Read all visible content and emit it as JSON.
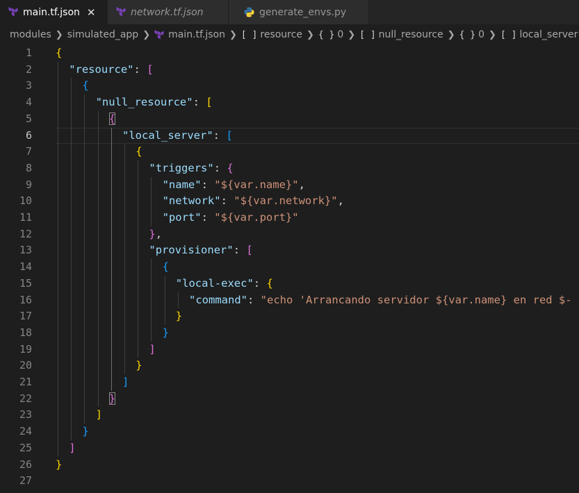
{
  "tabs": [
    {
      "label": "main.tf.json",
      "icon": "terraform-icon",
      "active": true,
      "italic": false,
      "close": "✕"
    },
    {
      "label": "network.tf.json",
      "icon": "terraform-icon",
      "active": false,
      "italic": true
    },
    {
      "label": "generate_envs.py",
      "icon": "python-icon",
      "active": false,
      "italic": false
    }
  ],
  "breadcrumb": [
    {
      "label": "modules"
    },
    {
      "label": "simulated_app"
    },
    {
      "label": "main.tf.json",
      "icon": "terraform-icon"
    },
    {
      "symbol": "[ ]",
      "label": "resource"
    },
    {
      "symbol": "{ }",
      "label": "0"
    },
    {
      "symbol": "[ ]",
      "label": "null_resource"
    },
    {
      "symbol": "{ }",
      "label": "0"
    },
    {
      "symbol": "[ ]",
      "label": "local_server"
    }
  ],
  "colors": {
    "terraform": "#7b42bc",
    "python_blue": "#3572a5",
    "python_yellow": "#ffd43b",
    "key": "#9cdcfe",
    "string": "#ce9178"
  },
  "editor": {
    "current_line": 6,
    "lines": [
      {
        "n": "1",
        "indent": 0,
        "tokens": [
          {
            "t": "{",
            "c": "b1"
          }
        ]
      },
      {
        "n": "2",
        "indent": 1,
        "tokens": [
          {
            "t": "\"resource\"",
            "c": "k"
          },
          {
            "t": ": ",
            "c": "p"
          },
          {
            "t": "[",
            "c": "b2"
          }
        ]
      },
      {
        "n": "3",
        "indent": 2,
        "tokens": [
          {
            "t": "{",
            "c": "b3"
          }
        ]
      },
      {
        "n": "4",
        "indent": 3,
        "tokens": [
          {
            "t": "\"null_resource\"",
            "c": "k"
          },
          {
            "t": ": ",
            "c": "p"
          },
          {
            "t": "[",
            "c": "b1"
          }
        ]
      },
      {
        "n": "5",
        "indent": 4,
        "tokens": [
          {
            "t": "{",
            "c": "b2",
            "boxed": true
          }
        ]
      },
      {
        "n": "6",
        "indent": 5,
        "tokens": [
          {
            "t": "\"local_server\"",
            "c": "k"
          },
          {
            "t": ": ",
            "c": "p"
          },
          {
            "t": "[",
            "c": "b3"
          }
        ]
      },
      {
        "n": "7",
        "indent": 6,
        "tokens": [
          {
            "t": "{",
            "c": "b1"
          }
        ]
      },
      {
        "n": "8",
        "indent": 7,
        "tokens": [
          {
            "t": "\"triggers\"",
            "c": "k"
          },
          {
            "t": ": ",
            "c": "p"
          },
          {
            "t": "{",
            "c": "b2"
          }
        ]
      },
      {
        "n": "9",
        "indent": 8,
        "tokens": [
          {
            "t": "\"name\"",
            "c": "k"
          },
          {
            "t": ": ",
            "c": "p"
          },
          {
            "t": "\"${var.name}\"",
            "c": "s"
          },
          {
            "t": ",",
            "c": "p"
          }
        ]
      },
      {
        "n": "10",
        "indent": 8,
        "tokens": [
          {
            "t": "\"network\"",
            "c": "k"
          },
          {
            "t": ": ",
            "c": "p"
          },
          {
            "t": "\"${var.network}\"",
            "c": "s"
          },
          {
            "t": ",",
            "c": "p"
          }
        ]
      },
      {
        "n": "11",
        "indent": 8,
        "tokens": [
          {
            "t": "\"port\"",
            "c": "k"
          },
          {
            "t": ": ",
            "c": "p"
          },
          {
            "t": "\"${var.port}\"",
            "c": "s"
          }
        ]
      },
      {
        "n": "12",
        "indent": 7,
        "tokens": [
          {
            "t": "}",
            "c": "b2"
          },
          {
            "t": ",",
            "c": "p"
          }
        ]
      },
      {
        "n": "13",
        "indent": 7,
        "tokens": [
          {
            "t": "\"provisioner\"",
            "c": "k"
          },
          {
            "t": ": ",
            "c": "p"
          },
          {
            "t": "[",
            "c": "b2"
          }
        ]
      },
      {
        "n": "14",
        "indent": 8,
        "tokens": [
          {
            "t": "{",
            "c": "b3"
          }
        ]
      },
      {
        "n": "15",
        "indent": 9,
        "tokens": [
          {
            "t": "\"local-exec\"",
            "c": "k"
          },
          {
            "t": ": ",
            "c": "p"
          },
          {
            "t": "{",
            "c": "b1"
          }
        ]
      },
      {
        "n": "16",
        "indent": 10,
        "tokens": [
          {
            "t": "\"command\"",
            "c": "k"
          },
          {
            "t": ": ",
            "c": "p"
          },
          {
            "t": "\"echo 'Arrancando servidor ${var.name} en red $-",
            "c": "s"
          }
        ]
      },
      {
        "n": "17",
        "indent": 9,
        "tokens": [
          {
            "t": "}",
            "c": "b1"
          }
        ]
      },
      {
        "n": "18",
        "indent": 8,
        "tokens": [
          {
            "t": "}",
            "c": "b3"
          }
        ]
      },
      {
        "n": "19",
        "indent": 7,
        "tokens": [
          {
            "t": "]",
            "c": "b2"
          }
        ]
      },
      {
        "n": "20",
        "indent": 6,
        "tokens": [
          {
            "t": "}",
            "c": "b1"
          }
        ]
      },
      {
        "n": "21",
        "indent": 5,
        "tokens": [
          {
            "t": "]",
            "c": "b3"
          }
        ]
      },
      {
        "n": "22",
        "indent": 4,
        "tokens": [
          {
            "t": "}",
            "c": "b2",
            "boxed": true
          }
        ]
      },
      {
        "n": "23",
        "indent": 3,
        "tokens": [
          {
            "t": "]",
            "c": "b1"
          }
        ]
      },
      {
        "n": "24",
        "indent": 2,
        "tokens": [
          {
            "t": "}",
            "c": "b3"
          }
        ]
      },
      {
        "n": "25",
        "indent": 1,
        "tokens": [
          {
            "t": "]",
            "c": "b2"
          }
        ]
      },
      {
        "n": "26",
        "indent": 0,
        "tokens": [
          {
            "t": "}",
            "c": "b1"
          }
        ]
      },
      {
        "n": "27",
        "indent": 0,
        "tokens": []
      }
    ]
  }
}
